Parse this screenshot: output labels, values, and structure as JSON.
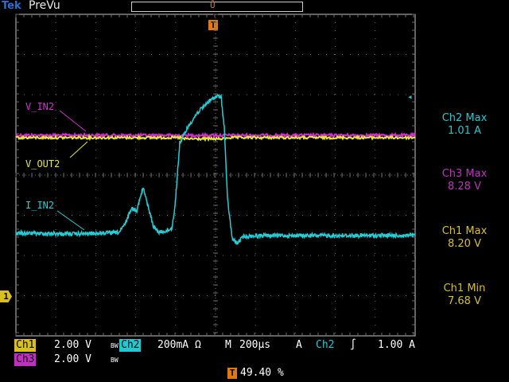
{
  "header": {
    "brand": "Tek",
    "mode": "PreVu"
  },
  "markers": {
    "trigger_position": "Ů",
    "trigger_T": "T",
    "ch1_ground": "1",
    "ch2_reference": "◂"
  },
  "traces": {
    "v_in2": {
      "label": "V_IN2",
      "color": "#d030d0"
    },
    "v_out2": {
      "label": "V_OUT2",
      "color": "#e8e830"
    },
    "i_in2": {
      "label": "I_IN2",
      "color": "#20d0d8"
    }
  },
  "measurements": [
    {
      "name": "Ch2 Max",
      "value": "1.01 A",
      "color": "#20c8d0"
    },
    {
      "name": "Ch3 Max",
      "value": "8.28 V",
      "color": "#c030c0"
    },
    {
      "name": "Ch1 Max",
      "value": "8.20 V",
      "color": "#d8c020"
    },
    {
      "name": "Ch1 Min",
      "value": "7.68 V",
      "color": "#d8c020"
    }
  ],
  "status": {
    "ch1": {
      "tag": "Ch1",
      "scale": "2.00 V",
      "bw": "BW"
    },
    "ch2": {
      "tag": "Ch2",
      "scale": "200mA Ω"
    },
    "ch3": {
      "tag": "Ch3",
      "scale": "2.00 V",
      "bw": "BW"
    },
    "timebase_prefix": "M",
    "timebase": "200µs",
    "trigger": {
      "mode": "A",
      "source": "Ch2",
      "slope": "∫",
      "level": "1.00 A"
    },
    "trigger_position_tag": "T",
    "trigger_position": "49.40 %"
  },
  "colors": {
    "grid": "#6a6a6a",
    "frame": "#c8c8c8",
    "accent_orange": "#e07a10"
  }
}
